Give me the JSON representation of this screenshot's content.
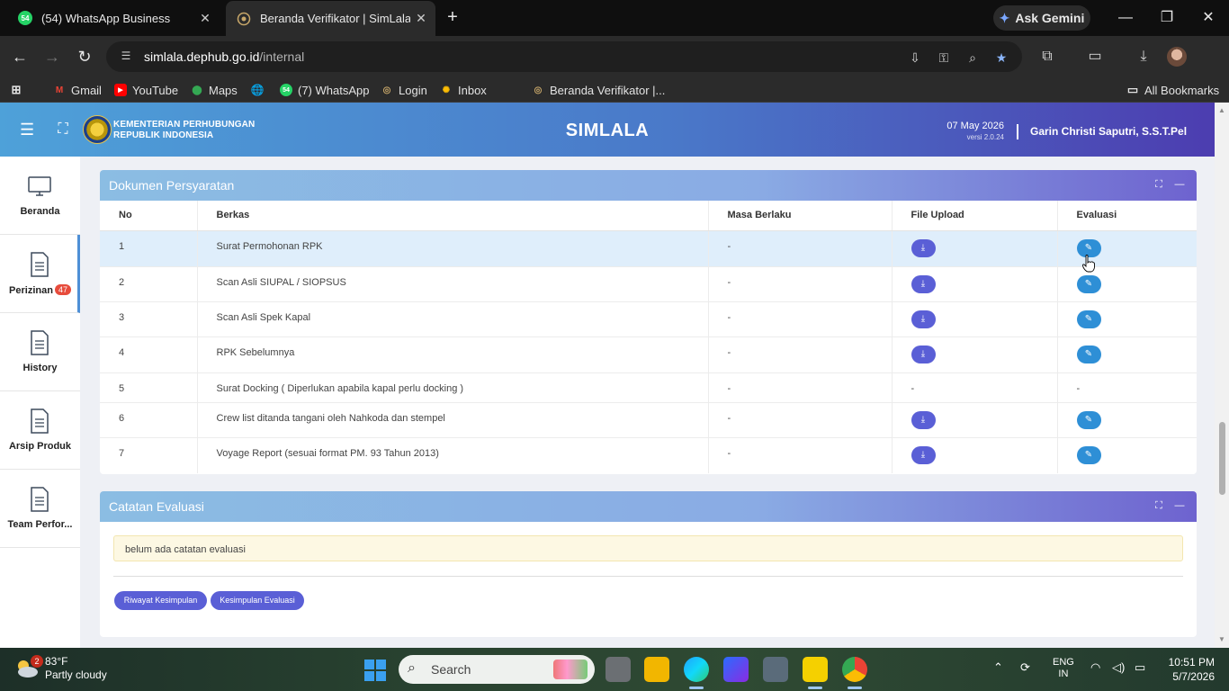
{
  "browser": {
    "tabs": [
      {
        "title": "(54) WhatsApp Business",
        "badge": "54"
      },
      {
        "title": "Beranda Verifikator | SimLala"
      }
    ],
    "gemini_label": "Ask Gemini",
    "url_domain": "simlala.dephub.go.id",
    "url_path": "/internal",
    "bookmarks": [
      {
        "label": "Gmail",
        "icon": "gmail-icon"
      },
      {
        "label": "YouTube",
        "icon": "youtube-icon"
      },
      {
        "label": "Maps",
        "icon": "maps-icon"
      },
      {
        "label": "",
        "icon": "globe-icon"
      },
      {
        "label": "(7) WhatsApp",
        "icon": "whatsapp-icon",
        "badge": "54"
      },
      {
        "label": "Login",
        "icon": "site-icon"
      },
      {
        "label": "Inbox",
        "icon": "photos-icon"
      },
      {
        "label": "Beranda Verifikator |...",
        "icon": "site-icon"
      }
    ],
    "all_bookmarks": "All Bookmarks"
  },
  "header": {
    "ministry_line1": "KEMENTERIAN PERHUBUNGAN",
    "ministry_line2": "REPUBLIK INDONESIA",
    "title": "SIMLALA",
    "date": "07 May 2026",
    "version": "versi 2.0.24",
    "user": "Garin Christi Saputri, S.S.T.Pel"
  },
  "sidebar": {
    "items": [
      {
        "label": "Beranda",
        "icon": "monitor-icon"
      },
      {
        "label": "Perizinan",
        "icon": "document-icon",
        "badge": "47"
      },
      {
        "label": "History",
        "icon": "document-icon"
      },
      {
        "label": "Arsip Produk",
        "icon": "document-icon"
      },
      {
        "label": "Team Perfor...",
        "icon": "document-icon"
      }
    ]
  },
  "documents": {
    "title": "Dokumen Persyaratan",
    "columns": [
      "No",
      "Berkas",
      "Masa Berlaku",
      "File Upload",
      "Evaluasi"
    ],
    "rows": [
      {
        "no": "1",
        "berkas": "Surat Permohonan RPK",
        "masa": "-",
        "upload": true,
        "eval": true
      },
      {
        "no": "2",
        "berkas": "Scan Asli SIUPAL / SIOPSUS",
        "masa": "-",
        "upload": true,
        "eval": true
      },
      {
        "no": "3",
        "berkas": "Scan Asli Spek Kapal",
        "masa": "-",
        "upload": true,
        "eval": true
      },
      {
        "no": "4",
        "berkas": "RPK Sebelumnya",
        "masa": "-",
        "upload": true,
        "eval": true
      },
      {
        "no": "5",
        "berkas": "Surat Docking ( Diperlukan apabila kapal perlu docking )",
        "masa": "-",
        "upload": false,
        "eval": false,
        "upload_text": "-",
        "eval_text": "-"
      },
      {
        "no": "6",
        "berkas": "Crew list ditanda tangani oleh Nahkoda dan stempel",
        "masa": "-",
        "upload": true,
        "eval": true
      },
      {
        "no": "7",
        "berkas": "Voyage Report (sesuai format PM. 93 Tahun 2013)",
        "masa": "-",
        "upload": true,
        "eval": true
      }
    ]
  },
  "evaluation": {
    "title": "Catatan Evaluasi",
    "note": "belum ada catatan evaluasi",
    "btn_history": "Riwayat Kesimpulan",
    "btn_conclusion": "Kesimpulan Evaluasi"
  },
  "taskbar": {
    "weather_badge": "2",
    "temperature": "83°F",
    "weather": "Partly cloudy",
    "search": "Search",
    "lang1": "ENG",
    "lang2": "IN",
    "time": "10:51 PM",
    "date": "5/7/2026"
  }
}
